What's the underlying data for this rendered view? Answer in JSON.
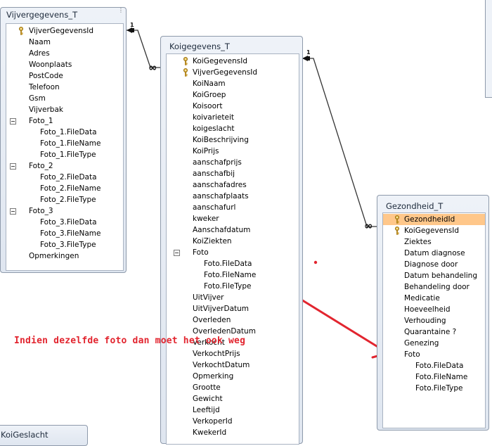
{
  "tables": {
    "vijver": {
      "title": "Vijvergegevens_T",
      "fields": [
        {
          "label": "VijverGegevensId",
          "key": true,
          "level": 0
        },
        {
          "label": "Naam",
          "level": 0
        },
        {
          "label": "Adres",
          "level": 0
        },
        {
          "label": "Woonplaats",
          "level": 0
        },
        {
          "label": "PostCode",
          "level": 0
        },
        {
          "label": "Telefoon",
          "level": 0
        },
        {
          "label": "Gsm",
          "level": 0
        },
        {
          "label": "Vijverbak",
          "level": 0
        },
        {
          "label": "Foto_1",
          "level": 0,
          "expand": true
        },
        {
          "label": "Foto_1.FileData",
          "level": 1
        },
        {
          "label": "Foto_1.FileName",
          "level": 1
        },
        {
          "label": "Foto_1.FileType",
          "level": 1
        },
        {
          "label": "Foto_2",
          "level": 0,
          "expand": true
        },
        {
          "label": "Foto_2.FileData",
          "level": 1
        },
        {
          "label": "Foto_2.FileName",
          "level": 1
        },
        {
          "label": "Foto_2.FileType",
          "level": 1
        },
        {
          "label": "Foto_3",
          "level": 0,
          "expand": true
        },
        {
          "label": "Foto_3.FileData",
          "level": 1
        },
        {
          "label": "Foto_3.FileName",
          "level": 1
        },
        {
          "label": "Foto_3.FileType",
          "level": 1
        },
        {
          "label": "Opmerkingen",
          "level": 0
        }
      ]
    },
    "koi": {
      "title": "Koigegevens_T",
      "fields": [
        {
          "label": "KoiGegevensId",
          "key": true,
          "level": 0
        },
        {
          "label": "VijverGegevensId",
          "key": true,
          "level": 0
        },
        {
          "label": "KoiNaam",
          "level": 0
        },
        {
          "label": "KoiGroep",
          "level": 0
        },
        {
          "label": "Koisoort",
          "level": 0
        },
        {
          "label": "koivarieteit",
          "level": 0
        },
        {
          "label": "koigeslacht",
          "level": 0
        },
        {
          "label": "KoiBeschrijving",
          "level": 0
        },
        {
          "label": "KoiPrijs",
          "level": 0
        },
        {
          "label": "aanschafprijs",
          "level": 0
        },
        {
          "label": "aanschafbij",
          "level": 0
        },
        {
          "label": "aanschafadres",
          "level": 0
        },
        {
          "label": "aanschafplaats",
          "level": 0
        },
        {
          "label": "aanschafurl",
          "level": 0
        },
        {
          "label": "kweker",
          "level": 0
        },
        {
          "label": "Aanschafdatum",
          "level": 0
        },
        {
          "label": "KoiZiekten",
          "level": 0
        },
        {
          "label": "Foto",
          "level": 0,
          "expand": true
        },
        {
          "label": "Foto.FileData",
          "level": 1
        },
        {
          "label": "Foto.FileName",
          "level": 1
        },
        {
          "label": "Foto.FileType",
          "level": 1
        },
        {
          "label": "UitVijver",
          "level": 0
        },
        {
          "label": "UitVijverDatum",
          "level": 0
        },
        {
          "label": "Overleden",
          "level": 0
        },
        {
          "label": "OverledenDatum",
          "level": 0
        },
        {
          "label": "Verkocht",
          "level": 0
        },
        {
          "label": "VerkochtPrijs",
          "level": 0
        },
        {
          "label": "VerkochtDatum",
          "level": 0
        },
        {
          "label": "Opmerking",
          "level": 0
        },
        {
          "label": "Grootte",
          "level": 0
        },
        {
          "label": "Gewicht",
          "level": 0
        },
        {
          "label": "Leeftijd",
          "level": 0
        },
        {
          "label": "VerkoperId",
          "level": 0
        },
        {
          "label": "KwekerId",
          "level": 0
        }
      ]
    },
    "gezondheid": {
      "title": "Gezondheid_T",
      "fields": [
        {
          "label": "GezondheidId",
          "key": true,
          "level": 0,
          "selected": true
        },
        {
          "label": "KoiGegevensId",
          "key": true,
          "level": 0
        },
        {
          "label": "Ziektes",
          "level": 0
        },
        {
          "label": "Datum diagnose",
          "level": 0
        },
        {
          "label": "Diagnose door",
          "level": 0
        },
        {
          "label": "Datum behandeling",
          "level": 0
        },
        {
          "label": "Behandeling door",
          "level": 0
        },
        {
          "label": "Medicatie",
          "level": 0
        },
        {
          "label": "Hoeveelheid",
          "level": 0
        },
        {
          "label": "Verhouding",
          "level": 0
        },
        {
          "label": "Quarantaine ?",
          "level": 0
        },
        {
          "label": "Genezing",
          "level": 0
        },
        {
          "label": "Foto",
          "level": 0
        },
        {
          "label": "Foto.FileData",
          "level": 1
        },
        {
          "label": "Foto.FileName",
          "level": 1
        },
        {
          "label": "Foto.FileType",
          "level": 1
        }
      ]
    },
    "partial": {
      "title": "KoiGeslacht"
    }
  },
  "relationships": {
    "one_label": "1",
    "many_label": "∞"
  },
  "annotation": {
    "text": "Indien dezelfde foto dan moet het ook weg",
    "color": "#e2252f"
  },
  "icons": {
    "key": "key-icon",
    "expand": "collapse-minus-icon"
  }
}
